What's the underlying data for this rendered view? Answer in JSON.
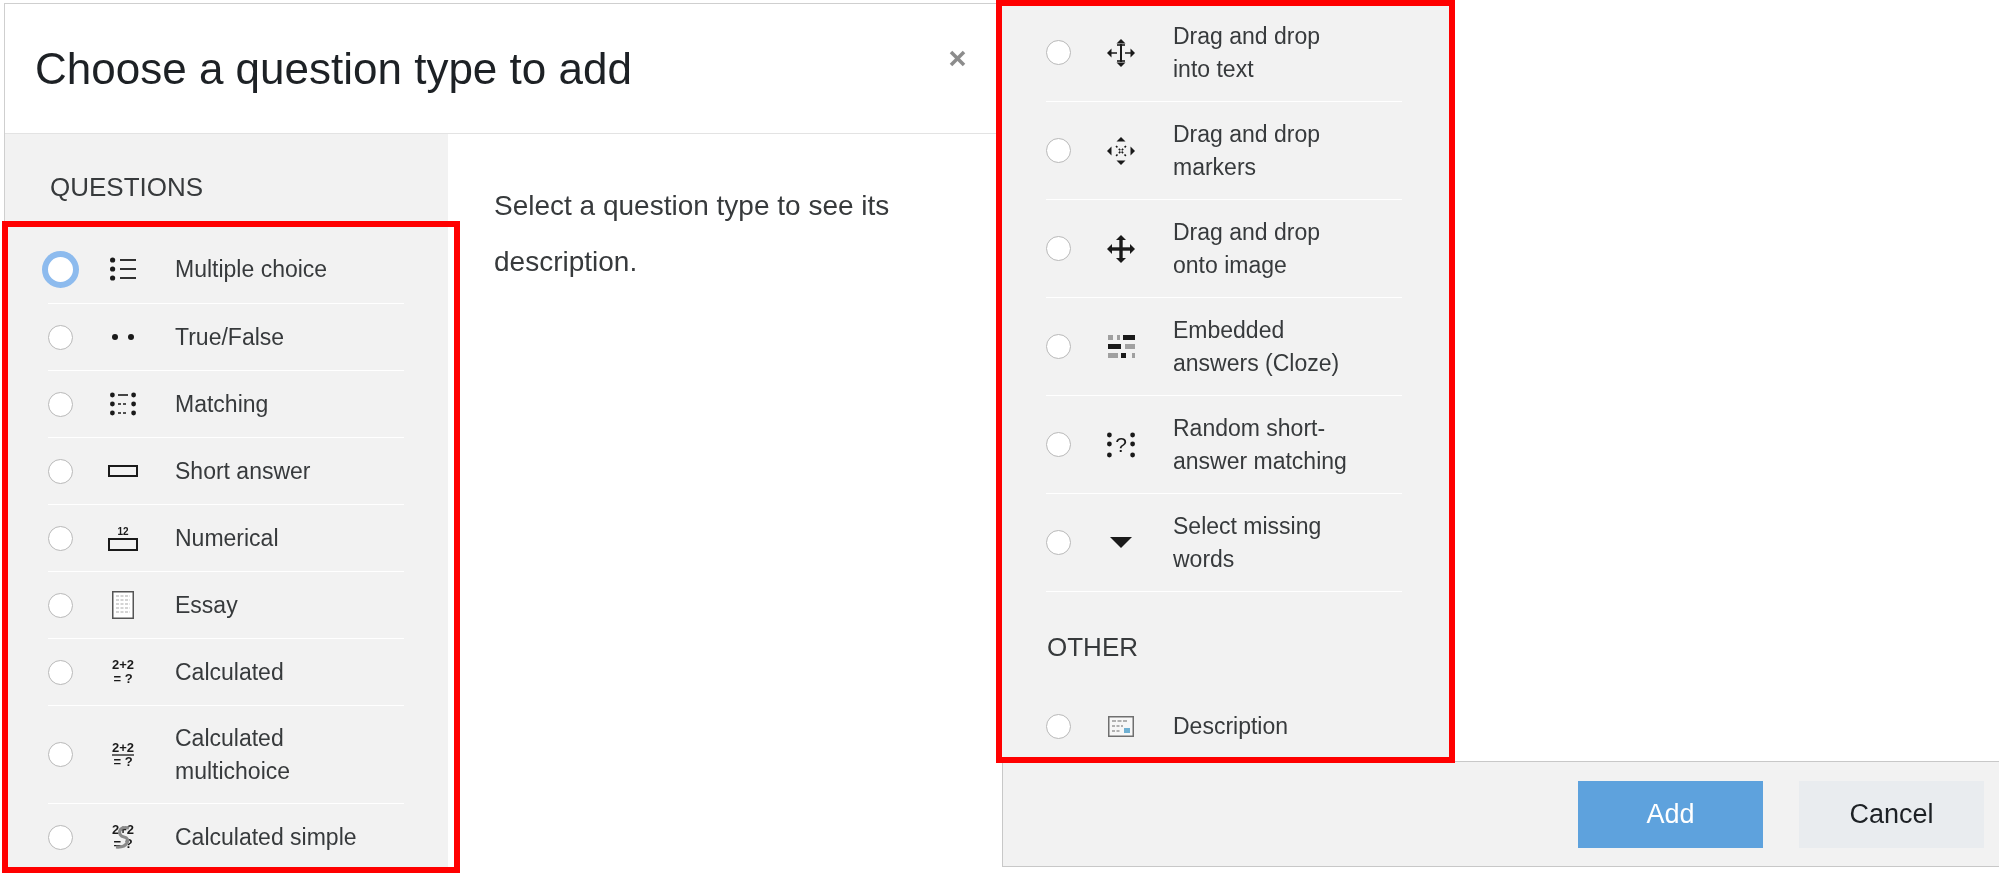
{
  "dialog": {
    "title": "Choose a question type to add"
  },
  "questions": {
    "heading": "QUESTIONS",
    "items": [
      {
        "label": "Multiple choice",
        "kind": "multichoice",
        "selected": false,
        "focused": true
      },
      {
        "label": "True/False",
        "kind": "truefalse",
        "selected": false,
        "focused": false
      },
      {
        "label": "Matching",
        "kind": "match",
        "selected": false,
        "focused": false
      },
      {
        "label": "Short answer",
        "kind": "shortanswer",
        "selected": false,
        "focused": false
      },
      {
        "label": "Numerical",
        "kind": "numerical",
        "icon_text": [
          "12"
        ],
        "selected": false,
        "focused": false
      },
      {
        "label": "Essay",
        "kind": "essay",
        "selected": false,
        "focused": false
      },
      {
        "label": "Calculated",
        "kind": "calculated",
        "icon_text": [
          "2+2",
          "= ?"
        ],
        "selected": false,
        "focused": false
      },
      {
        "label": "Calculated multichoice",
        "kind": "calculatedmulti",
        "icon_text": [
          "2+2",
          "= ?"
        ],
        "selected": false,
        "focused": false
      },
      {
        "label": "Calculated simple",
        "kind": "calculatedsimple",
        "icon_text": [
          "2+2",
          "= ?"
        ],
        "selected": false,
        "focused": false
      }
    ]
  },
  "details": {
    "text": "Select a question type to see its description."
  },
  "questions_continued": {
    "items": [
      {
        "label": "Drag and drop into text",
        "kind": "ddwtos",
        "selected": false,
        "focused": false
      },
      {
        "label": "Drag and drop markers",
        "kind": "ddmarker",
        "selected": false,
        "focused": false
      },
      {
        "label": "Drag and drop onto image",
        "kind": "ddimageortext",
        "selected": false,
        "focused": false
      },
      {
        "label": "Embedded answers (Cloze)",
        "kind": "multianswer",
        "selected": false,
        "focused": false
      },
      {
        "label": "Random short-answer matching",
        "kind": "randomsamatch",
        "icon_text": [
          "?"
        ],
        "selected": false,
        "focused": false
      },
      {
        "label": "Select missing words",
        "kind": "gapselect",
        "selected": false,
        "focused": false
      }
    ]
  },
  "other": {
    "heading": "OTHER",
    "items": [
      {
        "label": "Description",
        "kind": "description",
        "selected": false,
        "focused": false
      }
    ]
  },
  "footer": {
    "buttons": [
      {
        "label": "Add",
        "kind": "primary"
      },
      {
        "label": "Cancel",
        "kind": "secondary"
      }
    ]
  }
}
